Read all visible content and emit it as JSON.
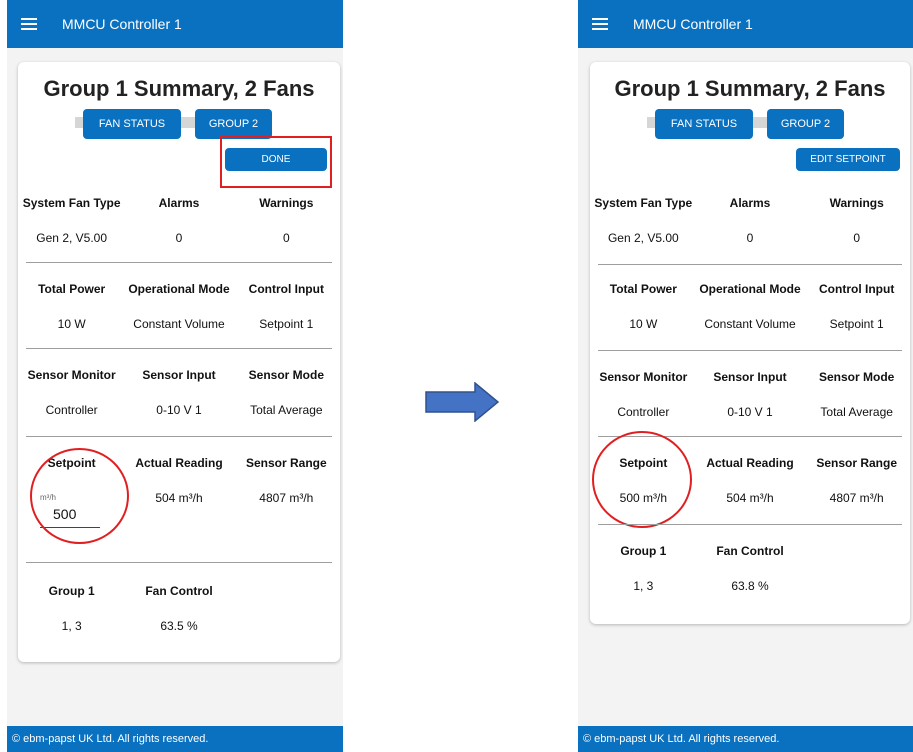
{
  "app": {
    "title": "MMCU Controller 1",
    "footer": "© ebm-papst UK Ltd. All rights reserved."
  },
  "before": {
    "card_title": "Group 1 Summary, 2 Fans",
    "tabs": [
      "FAN STATUS",
      "GROUP 2"
    ],
    "action_label": "DONE",
    "rows": [
      {
        "headers": [
          "System Fan Type",
          "Alarms",
          "Warnings"
        ],
        "values": [
          "Gen 2, V5.00",
          "0",
          "0"
        ]
      },
      {
        "headers": [
          "Total Power",
          "Operational Mode",
          "Control Input"
        ],
        "values": [
          "10 W",
          "Constant Volume",
          "Setpoint 1"
        ]
      },
      {
        "headers": [
          "Sensor Monitor",
          "Sensor Input",
          "Sensor Mode"
        ],
        "values": [
          "Controller",
          "0-10 V 1",
          "Total Average"
        ]
      },
      {
        "headers": [
          "Setpoint",
          "Actual Reading",
          "Sensor Range"
        ],
        "values": [
          "",
          "504 m³/h",
          "4807 m³/h"
        ]
      },
      {
        "headers": [
          "Group 1",
          "Fan Control",
          ""
        ],
        "values": [
          "1, 3",
          "63.5 %",
          ""
        ]
      }
    ],
    "setpoint_input": {
      "unit": "m³/h",
      "value": "500"
    }
  },
  "after": {
    "card_title": "Group 1 Summary, 2 Fans",
    "tabs": [
      "FAN STATUS",
      "GROUP 2"
    ],
    "action_label": "EDIT SETPOINT",
    "rows": [
      {
        "headers": [
          "System Fan Type",
          "Alarms",
          "Warnings"
        ],
        "values": [
          "Gen 2, V5.00",
          "0",
          "0"
        ]
      },
      {
        "headers": [
          "Total Power",
          "Operational Mode",
          "Control Input"
        ],
        "values": [
          "10 W",
          "Constant Volume",
          "Setpoint 1"
        ]
      },
      {
        "headers": [
          "Sensor Monitor",
          "Sensor Input",
          "Sensor Mode"
        ],
        "values": [
          "Controller",
          "0-10 V 1",
          "Total Average"
        ]
      },
      {
        "headers": [
          "Setpoint",
          "Actual Reading",
          "Sensor Range"
        ],
        "values": [
          "500 m³/h",
          "504 m³/h",
          "4807 m³/h"
        ]
      },
      {
        "headers": [
          "Group 1",
          "Fan Control",
          ""
        ],
        "values": [
          "1, 3",
          "63.8 %",
          ""
        ]
      }
    ]
  },
  "colors": {
    "primary": "#0a71c0",
    "highlight": "#e02020",
    "arrow": "#4472c4"
  }
}
